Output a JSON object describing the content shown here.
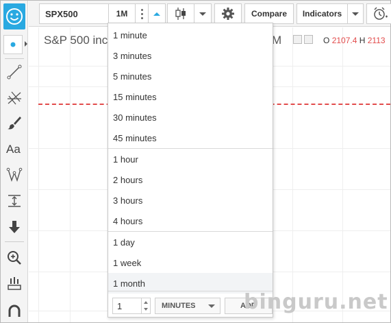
{
  "toolbar": {
    "symbol": "SPX500",
    "interval": "1M",
    "compare_label": "Compare",
    "indicators_label": "Indicators"
  },
  "chart": {
    "title": "S&P 500 inc",
    "title_tail": "M",
    "ohlc": {
      "open_label": "O",
      "open_value": "2107.4",
      "high_label": "H",
      "high_value": "2113"
    }
  },
  "interval_menu": {
    "groups": [
      {
        "items": [
          "1 minute",
          "3 minutes",
          "5 minutes",
          "15 minutes",
          "30 minutes",
          "45 minutes"
        ]
      },
      {
        "items": [
          "1 hour",
          "2 hours",
          "3 hours",
          "4 hours"
        ]
      },
      {
        "items": [
          "1 day",
          "1 week",
          "1 month"
        ]
      }
    ],
    "selected": "1 month",
    "custom": {
      "value": "1",
      "unit": "MINUTES",
      "add_label": "ADD"
    }
  },
  "watermark": "binguru.net",
  "colors": {
    "accent": "#29a9e1",
    "price_value": "#e24b4b",
    "dashed_line": "#e24b4b"
  }
}
